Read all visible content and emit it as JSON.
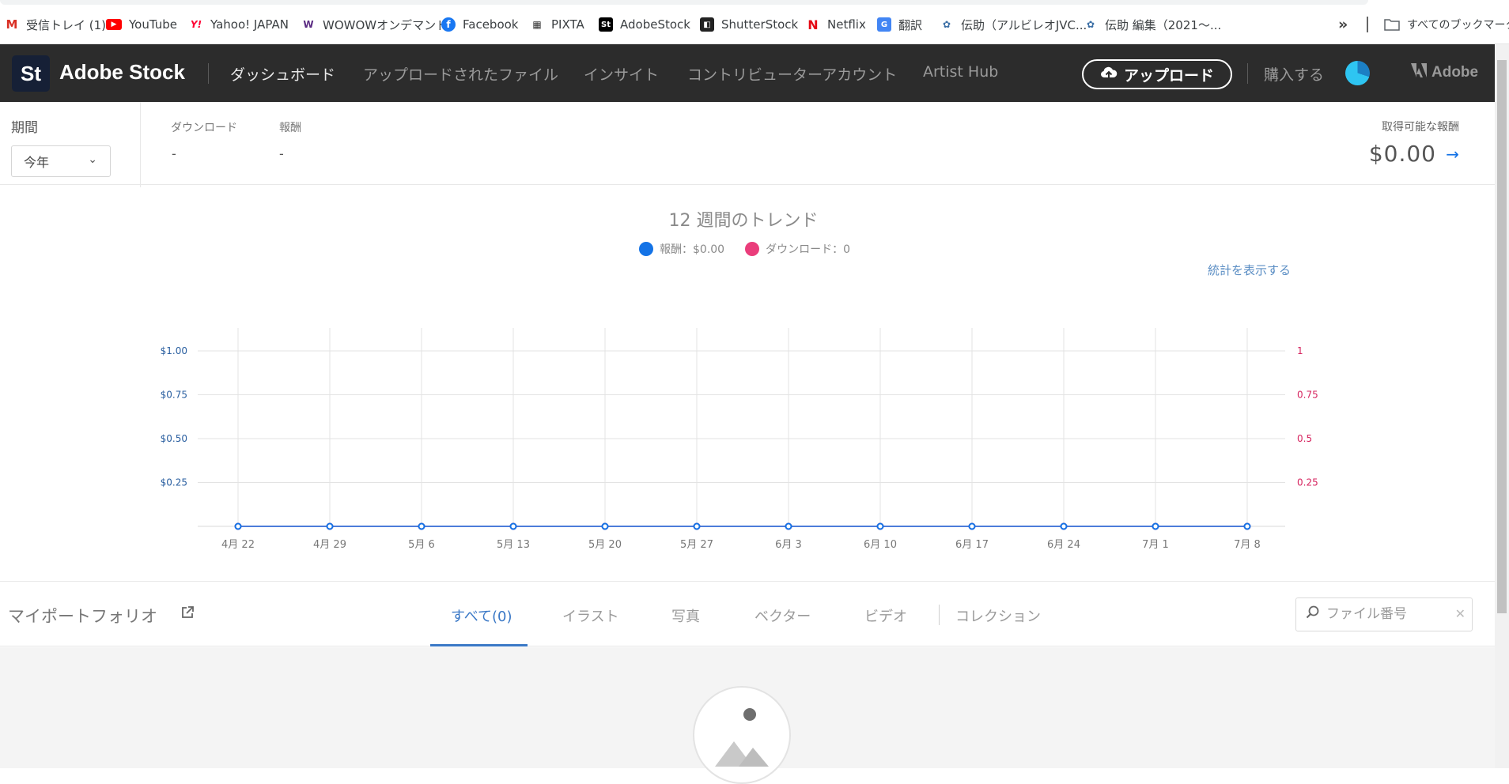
{
  "bookmarks": [
    {
      "label": "受信トレイ (1)",
      "icon": "gmail-icon",
      "color": "#d93025"
    },
    {
      "label": "YouTube",
      "icon": "youtube-icon",
      "color": "#ff0000"
    },
    {
      "label": "Yahoo! JAPAN",
      "icon": "yahoo-icon",
      "color": "#ff0033"
    },
    {
      "label": "WOWOWオンデマンド",
      "icon": "wowow-icon",
      "color": "#5a2a82"
    },
    {
      "label": "Facebook",
      "icon": "facebook-icon",
      "color": "#1877f2"
    },
    {
      "label": "PIXTA",
      "icon": "pixta-icon",
      "color": "#333333"
    },
    {
      "label": "AdobeStock",
      "icon": "adobestock-icon",
      "color": "#000000"
    },
    {
      "label": "ShutterStock",
      "icon": "shutterstock-icon",
      "color": "#222222"
    },
    {
      "label": "Netflix",
      "icon": "netflix-icon",
      "color": "#e50914"
    },
    {
      "label": "翻訳",
      "icon": "translate-icon",
      "color": "#4285f4"
    },
    {
      "label": "伝助（アルビレオJVC...",
      "icon": "densuke-icon",
      "color": "#3a6ea5"
    },
    {
      "label": "伝助 編集（2021〜...",
      "icon": "densuke-icon",
      "color": "#3a6ea5"
    }
  ],
  "bookmarks_more": "»",
  "bookmarks_folder": "すべてのブックマーク",
  "header": {
    "logo_mark": "St",
    "logo_text": "Adobe Stock",
    "nav": [
      "ダッシュボード",
      "アップロードされたファイル",
      "インサイト",
      "コントリビューターアカウント",
      "Artist Hub"
    ],
    "upload_label": "アップロード",
    "buy_label": "購入する",
    "brand_label": "Adobe"
  },
  "stats": {
    "period_label": "期間",
    "period_value": "今年",
    "downloads_label": "ダウンロード",
    "downloads_value": "-",
    "earnings_label": "報酬",
    "earnings_value": "-",
    "available_label": "取得可能な報酬",
    "available_value": "$0.00"
  },
  "chart": {
    "title": "12 週間のトレンド",
    "legend_earnings": "報酬：$0.00",
    "legend_downloads": "ダウンロード：0",
    "stats_link": "統計を表示する"
  },
  "chart_data": {
    "type": "line",
    "title": "12 週間のトレンド",
    "x": [
      "4月 22",
      "4月 29",
      "5月 6",
      "5月 13",
      "5月 20",
      "5月 27",
      "6月 3",
      "6月 10",
      "6月 17",
      "6月 24",
      "7月 1",
      "7月 8"
    ],
    "series": [
      {
        "name": "報酬",
        "axis": "left",
        "color": "#1473e6",
        "values": [
          0,
          0,
          0,
          0,
          0,
          0,
          0,
          0,
          0,
          0,
          0,
          0
        ]
      },
      {
        "name": "ダウンロード",
        "axis": "right",
        "color": "#e8306f",
        "values": [
          0,
          0,
          0,
          0,
          0,
          0,
          0,
          0,
          0,
          0,
          0,
          0
        ]
      }
    ],
    "left_ticks": [
      "$0.25",
      "$0.50",
      "$0.75",
      "$1.00"
    ],
    "right_ticks": [
      "0.25",
      "0.5",
      "0.75",
      "1"
    ],
    "ylim_left": [
      0,
      1
    ],
    "ylim_right": [
      0,
      1
    ],
    "grid": true,
    "legend_position": "top-center",
    "colors": {
      "left_axis": "#2a5fa0",
      "right_axis": "#d6245f",
      "grid": "#e3e3e3"
    }
  },
  "portfolio": {
    "title": "マイポートフォリオ",
    "tabs": [
      "すべて(0)",
      "イラスト",
      "写真",
      "ベクター",
      "ビデオ",
      "コレクション"
    ],
    "search_placeholder": "ファイル番号"
  }
}
